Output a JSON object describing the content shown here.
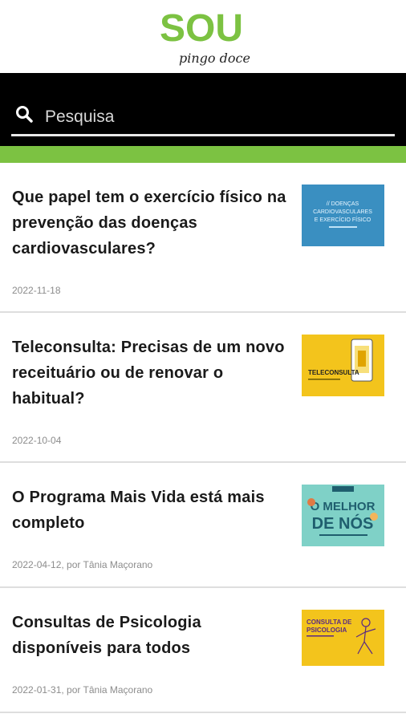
{
  "brand": {
    "logo_text": "SOU",
    "logo_subtitle": "pingo doce",
    "accent_color": "#7cc242"
  },
  "search": {
    "placeholder": "Pesquisa",
    "icon": "search-icon"
  },
  "articles": [
    {
      "title": "Que papel tem o exercício físico na prevenção das doenças cardiovasculares?",
      "meta": "2022-11-18",
      "thumb_text": "// DOENÇAS CARDIOVASCULARES E EXERCÍCIO FÍSICO",
      "thumb_color": "#3a8fc1"
    },
    {
      "title": "Teleconsulta: Precisas de um novo receituário ou de renovar o habitual?",
      "meta": "2022-10-04",
      "thumb_text": "TELECONSULTA",
      "thumb_color": "#f3c41c"
    },
    {
      "title": "O Programa Mais Vida está mais completo",
      "meta": "2022-04-12, por Tânia Maçorano",
      "thumb_text": "O MELHOR DE NÓS",
      "thumb_color": "#7fd1c7"
    },
    {
      "title": "Consultas de Psicologia disponíveis para todos",
      "meta": "2022-01-31, por Tânia Maçorano",
      "thumb_text": "CONSULTA DE PSICOLOGIA",
      "thumb_color": "#f3c41c"
    }
  ]
}
